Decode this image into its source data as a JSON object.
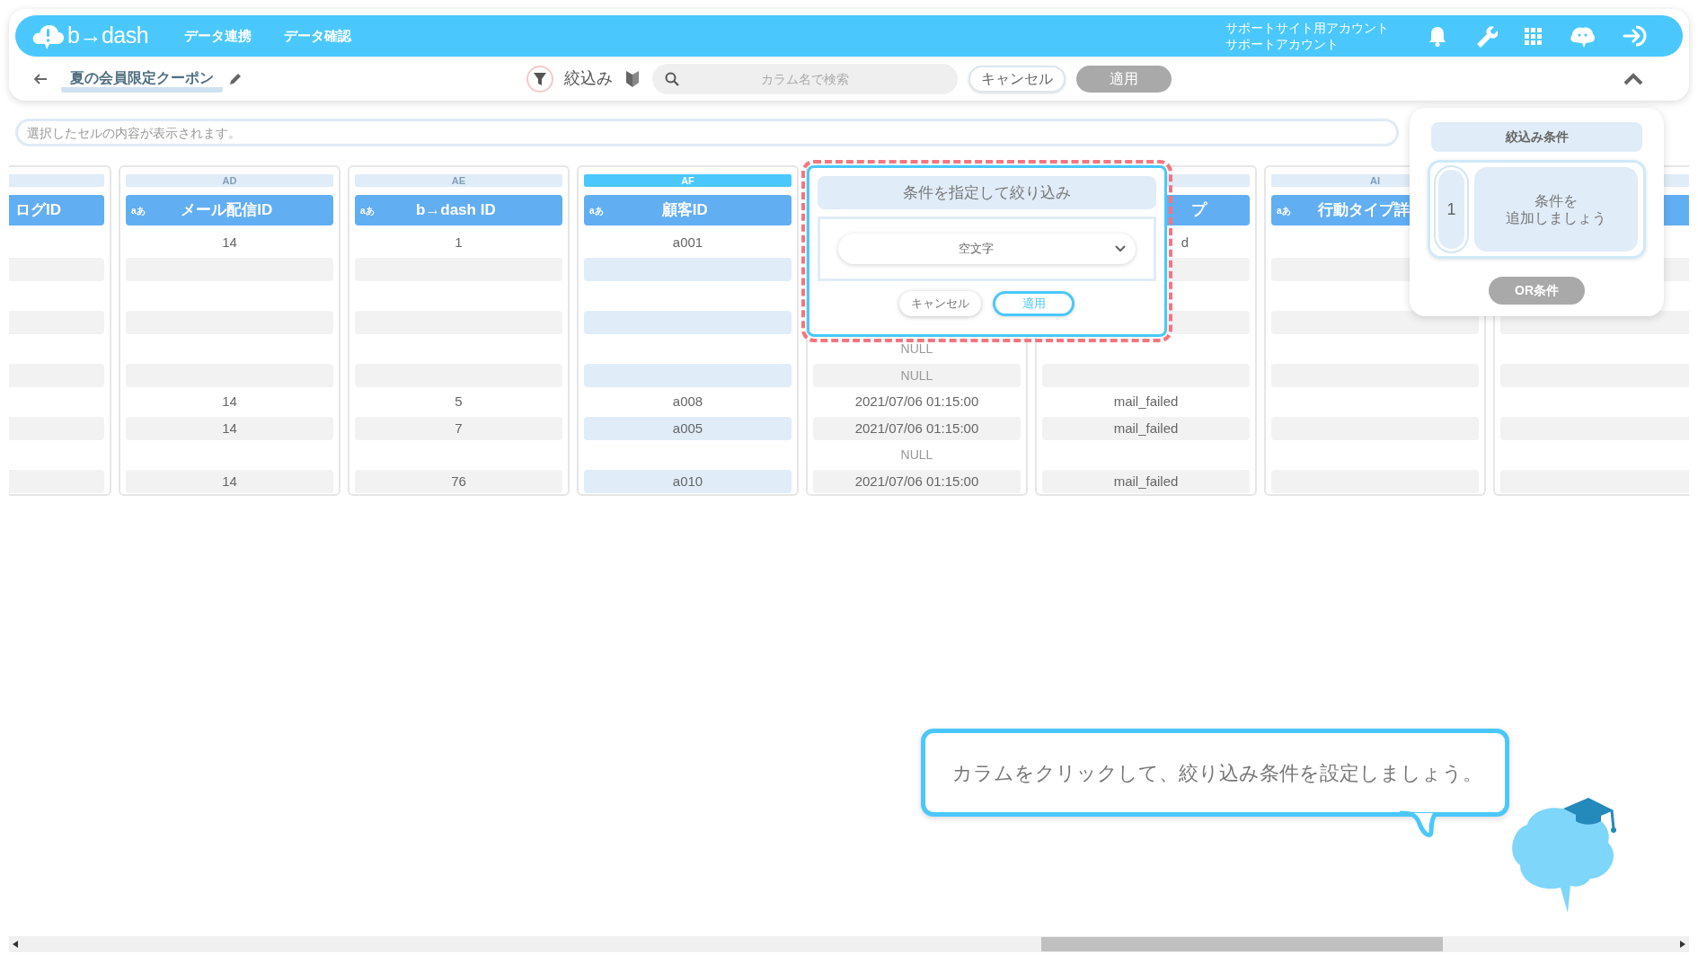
{
  "header": {
    "logo": "b→dash",
    "nav": [
      {
        "label": "データ連携"
      },
      {
        "label": "データ確認"
      }
    ],
    "account": {
      "site": "サポートサイト用アカウント",
      "name": "サポートアカウント"
    }
  },
  "toolbar": {
    "title": "夏の会員限定クーポン",
    "filter_label": "絞込み",
    "search": {
      "placeholder": "カラム名で検索"
    },
    "buttons": [
      {
        "label": "キャンセル",
        "disabled": false
      },
      {
        "label": "適用",
        "disabled": true
      }
    ]
  },
  "cell_viewer": {
    "placeholder": "選択したセルの内容が表示されます。"
  },
  "columns": [
    {
      "name": "ログID",
      "kind": "cut-left",
      "selected": false
    },
    {
      "letter": "AD",
      "type_label": "aあ",
      "name": "メール配信ID",
      "kind": "full",
      "selected": false,
      "cells": [
        "14",
        null,
        null,
        null,
        null,
        null,
        "14",
        "14",
        null,
        "14"
      ]
    },
    {
      "letter": "AE",
      "type_label": "aあ",
      "name": "b→dash ID",
      "kind": "full",
      "selected": false,
      "cells": [
        "1",
        null,
        null,
        null,
        null,
        null,
        "5",
        "7",
        null,
        "76"
      ]
    },
    {
      "letter": "AF",
      "type_label": "aあ",
      "name": "顧客ID",
      "kind": "full",
      "selected": true,
      "cells": [
        "a001",
        null,
        null,
        null,
        null,
        null,
        "a008",
        "a005",
        null,
        "a010"
      ]
    },
    {
      "kind": "hidden",
      "cells": [
        null,
        null,
        null,
        null,
        {
          "text": "NULL",
          "kind": "null"
        },
        {
          "text": "NULL",
          "kind": "null"
        },
        "2021/07/06 01:15:00",
        "2021/07/06 01:15:00",
        {
          "text": "NULL",
          "kind": "null"
        },
        "2021/07/06 01:15:00"
      ]
    },
    {
      "name": "プ",
      "kind": "cut-left",
      "selected": false,
      "cells": [
        {
          "text": "d",
          "kind": "cut-left"
        },
        null,
        null,
        null,
        null,
        null,
        "mail_failed",
        "mail_failed",
        null,
        "mail_failed"
      ]
    },
    {
      "letter": "AI",
      "type_label": "aあ",
      "name": "行動タイプ詳",
      "kind": "cut-right",
      "selected": false
    },
    {
      "kind": "hidden"
    }
  ],
  "filter_popup": {
    "title": "条件を指定して絞り込み",
    "dropdown": "空文字",
    "buttons": [
      {
        "label": "キャンセル",
        "kind": "cancel"
      },
      {
        "label": "適用",
        "kind": "apply"
      }
    ]
  },
  "conditions_panel": {
    "title": "絞込み条件",
    "conditions": [
      {
        "number": "1",
        "lines": [
          "条件を",
          "追加しましょう"
        ]
      }
    ],
    "or_button": {
      "label": "OR条件",
      "disabled": true
    }
  },
  "guide": {
    "message": "カラムをクリックして、絞り込み条件を設定しましょう。"
  }
}
